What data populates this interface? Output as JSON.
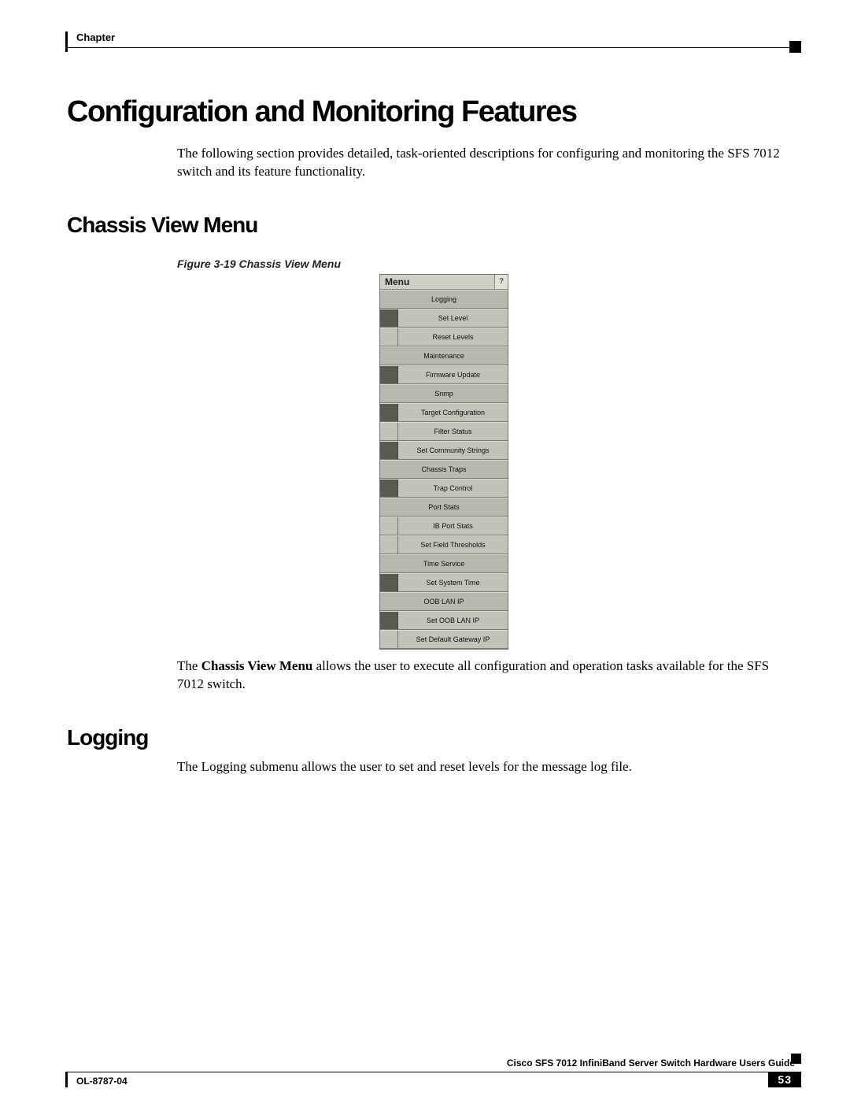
{
  "header": {
    "chapter_label": "Chapter"
  },
  "main": {
    "title": "Configuration and Monitoring Features",
    "intro": "The following section provides detailed, task-oriented descriptions for configuring and monitoring the SFS 7012 switch and its feature functionality.",
    "section1_title": "Chassis View Menu",
    "figure_caption": "Figure 3-19   Chassis View Menu",
    "desc1_bold": "Chassis View Menu",
    "desc1_before": "The ",
    "desc1_after": " allows the user to execute all configuration and operation tasks available for the SFS 7012 switch.",
    "section2_title": "Logging",
    "desc2": "The Logging submenu allows the user to set and reset levels for the message log file."
  },
  "menu": {
    "title": "Menu",
    "help": "?",
    "rows": [
      {
        "label": "Logging",
        "type": "header"
      },
      {
        "label": "Set Level",
        "type": "dark"
      },
      {
        "label": "Reset Levels",
        "type": "plain"
      },
      {
        "label": "Maintenance",
        "type": "header"
      },
      {
        "label": "Firmware Update",
        "type": "dark"
      },
      {
        "label": "Snmp",
        "type": "header"
      },
      {
        "label": "Target Configuration",
        "type": "dark"
      },
      {
        "label": "Filter Status",
        "type": "plain"
      },
      {
        "label": "Set Community Strings",
        "type": "dark"
      },
      {
        "label": "Chassis Traps",
        "type": "header"
      },
      {
        "label": "Trap Control",
        "type": "dark"
      },
      {
        "label": "Port Stats",
        "type": "header"
      },
      {
        "label": "IB Port Stats",
        "type": "plain"
      },
      {
        "label": "Set Field Thresholds",
        "type": "plain"
      },
      {
        "label": "Time Service",
        "type": "header"
      },
      {
        "label": "Set System Time",
        "type": "dark"
      },
      {
        "label": "OOB LAN IP",
        "type": "header"
      },
      {
        "label": "Set OOB LAN IP",
        "type": "dark"
      },
      {
        "label": "Set Default Gateway IP",
        "type": "plain"
      }
    ]
  },
  "footer": {
    "book_title": "Cisco SFS 7012 InfiniBand Server Switch Hardware Users Guide",
    "doc_number": "OL-8787-04",
    "page_number": "53"
  }
}
